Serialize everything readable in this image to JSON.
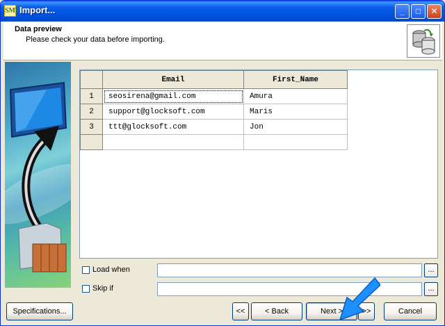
{
  "window": {
    "title": "Import...",
    "app_icon_text": "SMT"
  },
  "controls": {
    "minimize": "_",
    "maximize": "□",
    "close": "✕"
  },
  "header": {
    "title": "Data preview",
    "subtitle": "Please check your data before importing.",
    "icon": "database-import-icon"
  },
  "grid": {
    "columns": [
      "Email",
      "First_Name"
    ],
    "rows": [
      {
        "num": "1",
        "email": "seosirena@gmail.com",
        "first_name": "Amura"
      },
      {
        "num": "2",
        "email": "support@glocksoft.com",
        "first_name": "Maris"
      },
      {
        "num": "3",
        "email": "ttt@glocksoft.com",
        "first_name": "Jon"
      }
    ]
  },
  "filters": {
    "load_when": {
      "label": "Load when",
      "value": ""
    },
    "skip_if": {
      "label": "Skip if",
      "value": ""
    },
    "ellipsis": "..."
  },
  "buttons": {
    "specifications": "Specifications...",
    "first": "<<",
    "back": "< Back",
    "next": "Next >",
    "last": ">>",
    "cancel": "Cancel"
  },
  "colors": {
    "titlebar": "#0053E1",
    "face": "#ECE9D8",
    "annotation": "#1E8FFF"
  }
}
